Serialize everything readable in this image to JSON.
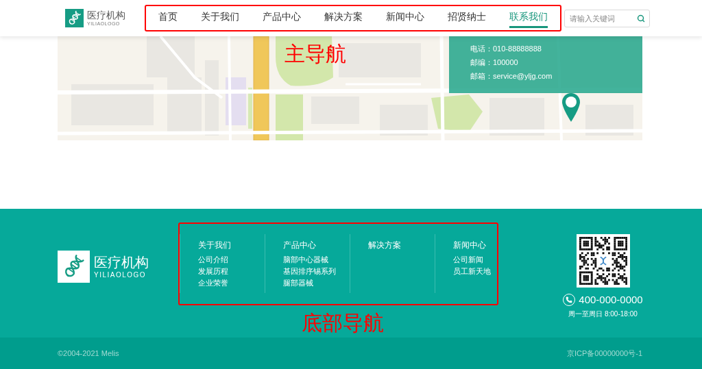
{
  "header": {
    "logo": {
      "title": "医疗机构",
      "subtitle": "YILIAOLOGO"
    },
    "nav": [
      {
        "label": "首页",
        "selected": false
      },
      {
        "label": "关于我们",
        "selected": false
      },
      {
        "label": "产品中心",
        "selected": false
      },
      {
        "label": "解决方案",
        "selected": false
      },
      {
        "label": "新闻中心",
        "selected": false
      },
      {
        "label": "招贤纳士",
        "selected": false
      },
      {
        "label": "联系我们",
        "selected": true
      }
    ],
    "search": {
      "placeholder": "请输入关键词"
    }
  },
  "map": {
    "contact": [
      "电话：010-88888888",
      "邮编：100000",
      "邮箱：service@yljg.com"
    ]
  },
  "footer": {
    "logo": {
      "title": "医疗机构",
      "subtitle": "YILIAOLOGO"
    },
    "columns": [
      {
        "title": "关于我们",
        "links": [
          "公司介绍",
          "发展历程",
          "企业荣誉"
        ]
      },
      {
        "title": "产品中心",
        "links": [
          "脑部中心器械",
          "基因排序锡系列",
          "腿部器械"
        ]
      },
      {
        "title": "解决方案"
      },
      {
        "title": "新闻中心",
        "links": [
          "公司新闻",
          "员工新天地"
        ]
      }
    ],
    "hotline": {
      "phone": "400-000-0000",
      "hours": "周一至周日 8:00-18:00"
    }
  },
  "bottom_bar": {
    "copyright": "©2004-2021 Melis",
    "icp": "京ICP备00000000号-1"
  },
  "annotations": [
    {
      "kind": "header_nav",
      "label": "主导航"
    },
    {
      "kind": "footer_nav",
      "label": "底部导航"
    }
  ]
}
